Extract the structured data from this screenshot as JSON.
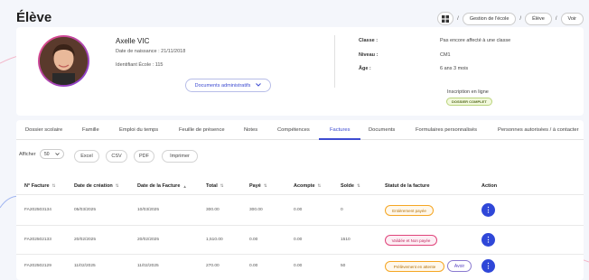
{
  "page": {
    "title": "Élève"
  },
  "breadcrumb": {
    "items": [
      "Gestion de l'école",
      "Élève",
      "Voir"
    ],
    "separator": "/"
  },
  "student": {
    "name": "Axelle VIC",
    "dob": "Date de naissance : 21/11/2018",
    "school_id": "Identifiant École : 115",
    "documents_button": "Documents administratifs",
    "fields": [
      {
        "label": "Classe :",
        "value": "Pas encore affecté à une classe"
      },
      {
        "label": "Niveau :",
        "value": "CM1"
      },
      {
        "label": "Âge :",
        "value": "6 ans 3 mois"
      }
    ],
    "inscription_label": "Inscription en ligne",
    "inscription_badge": "DOSSIER COMPLET"
  },
  "tabs": [
    "Dossier scolaire",
    "Famille",
    "Emploi du temps",
    "Feuille de présence",
    "Notes",
    "Compétences",
    "Factures",
    "Documents",
    "Formulaires personnalisés",
    "Personnes autorisées / à contacter"
  ],
  "active_tab": "Factures",
  "controls": {
    "afficher_label": "Afficher",
    "page_size": "50",
    "export_buttons": [
      "Excel",
      "CSV",
      "PDF",
      "Imprimer"
    ]
  },
  "table": {
    "headers": [
      "N° Facture",
      "Date de création",
      "Date de la Facture",
      "Total",
      "Payé",
      "Acompte",
      "Solde",
      "Statut de la facture",
      "Action"
    ],
    "rows": [
      {
        "num": "FA202503134",
        "created": "05/03/2025",
        "date": "10/03/2025",
        "total": "300.00",
        "paid": "300.00",
        "deposit": "0.00",
        "balance": "0",
        "status": "Entièrement payée",
        "status_color": "#f5a623",
        "action_extra": ""
      },
      {
        "num": "FA202502133",
        "created": "20/02/2025",
        "date": "20/02/2025",
        "total": "1,510.00",
        "paid": "0.00",
        "deposit": "0.00",
        "balance": "1510",
        "status": "Validée et Non payée",
        "status_color": "#e0457b",
        "action_extra": ""
      },
      {
        "num": "FA202502129",
        "created": "11/02/2025",
        "date": "11/02/2025",
        "total": "270.00",
        "paid": "0.00",
        "deposit": "0.00",
        "balance": "50",
        "status": "Prélèvement en attente",
        "status_color": "#f5a623",
        "action_extra": "Avoir"
      }
    ]
  },
  "colors": {
    "accent": "#3d4bd1",
    "action": "#2f47d8",
    "badge_green": "#b9d37a"
  }
}
